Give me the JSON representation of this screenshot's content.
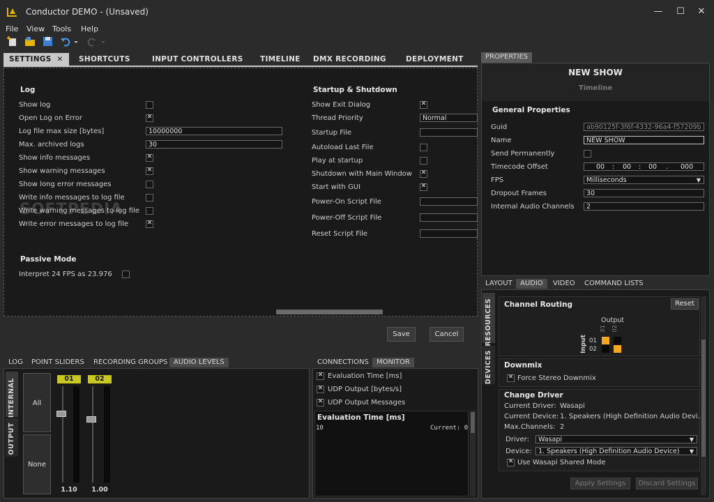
{
  "window": {
    "title": "Conductor DEMO - (Unsaved)",
    "minimize": "—",
    "maximize": "☐",
    "close": "✕"
  },
  "menu": [
    "File",
    "View",
    "Tools",
    "Help"
  ],
  "main_tabs": [
    {
      "label": "SETTINGS"
    },
    {
      "label": "SHORTCUTS"
    },
    {
      "label": "INPUT CONTROLLERS"
    },
    {
      "label": "TIMELINE"
    },
    {
      "label": "DMX RECORDING"
    },
    {
      "label": "DEPLOYMENT"
    }
  ],
  "log": {
    "header": "Log",
    "rows": [
      {
        "label": "Show log",
        "checked": false
      },
      {
        "label": "Open Log on Error",
        "checked": true
      },
      {
        "label": "Log file max size [bytes]",
        "value": "10000000"
      },
      {
        "label": "Max. archived logs",
        "value": "30"
      },
      {
        "label": "Show info messages",
        "checked": true
      },
      {
        "label": "Show warning messages",
        "checked": true
      },
      {
        "label": "Show long error messages",
        "checked": false
      },
      {
        "label": "Write info messages to log file",
        "checked": false
      },
      {
        "label": "Write warning messages to log file",
        "checked": false
      },
      {
        "label": "Write error messages to log file",
        "checked": true
      }
    ]
  },
  "passive": {
    "header": "Passive Mode",
    "label": "Interpret 24 FPS as 23.976",
    "checked": false
  },
  "startup": {
    "header": "Startup & Shutdown",
    "rows": [
      {
        "label": "Show Exit Dialog",
        "checked": true
      },
      {
        "label": "Thread Priority",
        "value": "Normal"
      },
      {
        "label": "Startup File",
        "value": ""
      },
      {
        "label": "Autoload Last File",
        "checked": false
      },
      {
        "label": "Play at startup",
        "checked": false
      },
      {
        "label": "Shutdown with Main Window",
        "checked": true
      },
      {
        "label": "Start with GUI",
        "checked": true
      },
      {
        "label": "Power-On Script File",
        "value": ""
      },
      {
        "label": "Power-Off Script File",
        "value": ""
      },
      {
        "label": "Reset Script File",
        "value": ""
      }
    ]
  },
  "dialog_buttons": {
    "save": "Save",
    "cancel": "Cancel"
  },
  "properties": {
    "tab": "PROPERTIES",
    "show_name": "NEW SHOW",
    "show_type": "Timeline",
    "section": "General Properties",
    "rows": [
      {
        "label": "Guid",
        "value": "ab90125f-3f6f-4332-96a4-f57209b"
      },
      {
        "label": "Name",
        "value": "NEW SHOW"
      },
      {
        "label": "Send Permanently",
        "checked": false
      },
      {
        "label": "Timecode Offset",
        "tc": [
          "00",
          "00",
          "00",
          "000"
        ]
      },
      {
        "label": "FPS",
        "value": "Milliseconds"
      },
      {
        "label": "Dropout Frames",
        "value": "30"
      },
      {
        "label": "Internal Audio Channels",
        "value": "2"
      }
    ]
  },
  "right_tabs": [
    "LAYOUT",
    "AUDIO",
    "VIDEO",
    "COMMAND LISTS"
  ],
  "side_vtabs": [
    "RESOURCES",
    "DEVICES"
  ],
  "routing": {
    "header": "Channel Routing",
    "reset": "Reset",
    "output_label": "Output",
    "input_label": "Input",
    "outputs": [
      "01",
      "02"
    ],
    "inputs": [
      "01",
      "02"
    ]
  },
  "downmix": {
    "header": "Downmix",
    "label": "Force Stereo Downmix",
    "checked": true
  },
  "driver": {
    "header": "Change Driver",
    "current_driver_label": "Current Driver:",
    "current_driver": "Wasapi",
    "current_device_label": "Current Device:",
    "current_device": "1. Speakers (High Definition Audio Devi...",
    "max_channels_label": "Max.Channels:",
    "max_channels": "2",
    "driver_label": "Driver:",
    "driver_value": "Wasapi",
    "device_label": "Device:",
    "device_value": "1. Speakers (High Definition Audio Device)",
    "shared_label": "Use Wasapi Shared Mode",
    "shared_checked": true,
    "apply": "Apply Settings",
    "discard": "Discard Settings"
  },
  "bottom_tabs": [
    "LOG",
    "POINT SLIDERS",
    "RECORDING GROUPS",
    "AUDIO LEVELS"
  ],
  "levels": {
    "vtabs": [
      "INTERNAL",
      "OUTPUT"
    ],
    "all": "All",
    "none": "None",
    "channels": [
      {
        "id": "01",
        "value": "1.10",
        "level": 0.28
      },
      {
        "id": "02",
        "value": "1.00",
        "level": 0.34
      }
    ]
  },
  "monitor_tabs": [
    "CONNECTIONS",
    "MONITOR"
  ],
  "monitor": {
    "items": [
      {
        "label": "Evaluation Time [ms]",
        "checked": true
      },
      {
        "label": "UDP Output [bytes/s]",
        "checked": true
      },
      {
        "label": "UDP Output Messages",
        "checked": true
      }
    ],
    "graph_title": "Evaluation Time [ms]",
    "axis_max": "10",
    "current": "Current: 0"
  },
  "watermark": "SOFTPEDIA",
  "colors": {
    "bg": "#2b2b2b",
    "panel": "#1a1a1a",
    "accent_yellow": "#c8c81e",
    "orange": "#f5a623"
  }
}
